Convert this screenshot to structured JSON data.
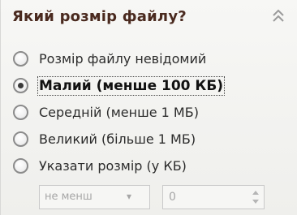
{
  "section": {
    "title": "Який розмір файлу?",
    "collapse_icon": "chevron-double-up-icon"
  },
  "options": [
    {
      "label": "Розмір файлу невідомий",
      "checked": false
    },
    {
      "label": "Малий (менше 100 КБ)",
      "checked": true
    },
    {
      "label": "Середній (менше 1 МБ)",
      "checked": false
    },
    {
      "label": "Великий (більше 1 МБ)",
      "checked": false
    },
    {
      "label": "Указати розмір (у КБ)",
      "checked": false
    }
  ],
  "custom_size": {
    "comparison_value": "не менш",
    "size_value": "0"
  }
}
